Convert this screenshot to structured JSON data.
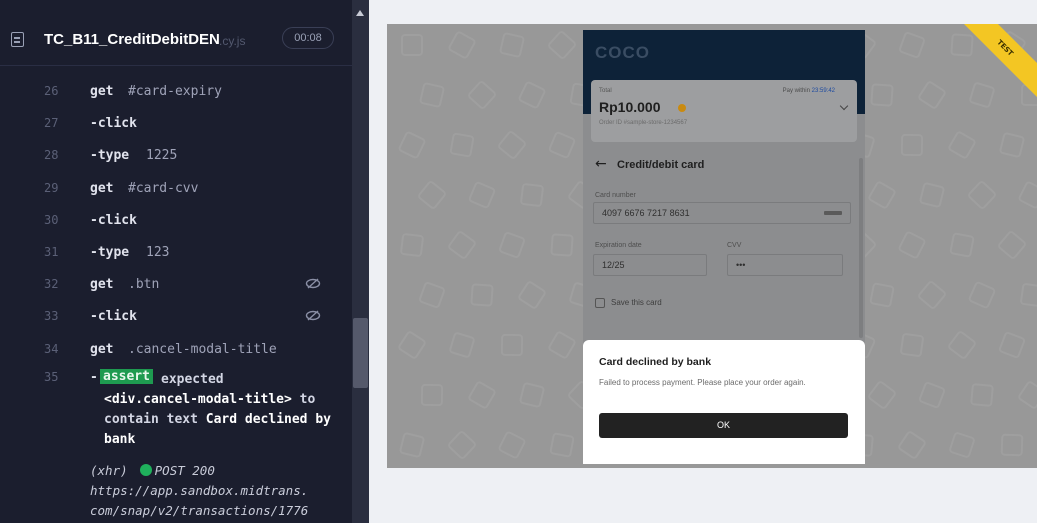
{
  "runner": {
    "spec_name": "TC_B11_CreditDebitDEN",
    "spec_ext": ".cy.js",
    "timer": "00:08"
  },
  "commands": [
    {
      "num": "26",
      "cmd": "get",
      "arg": "#card-expiry"
    },
    {
      "num": "27",
      "cmd": "-click",
      "arg": ""
    },
    {
      "num": "28",
      "cmd": "-type",
      "arg": "1225"
    },
    {
      "num": "29",
      "cmd": "get",
      "arg": "#card-cvv"
    },
    {
      "num": "30",
      "cmd": "-click",
      "arg": ""
    },
    {
      "num": "31",
      "cmd": "-type",
      "arg": "123"
    },
    {
      "num": "32",
      "cmd": "get",
      "arg": ".btn",
      "icon": "eye-slash-icon"
    },
    {
      "num": "33",
      "cmd": "-click",
      "arg": "",
      "icon": "eye-slash-icon"
    },
    {
      "num": "34",
      "cmd": "get",
      "arg": ".cancel-modal-title"
    }
  ],
  "assertion": {
    "num": "35",
    "dash": "-",
    "badge": "assert",
    "w1": "expected",
    "subject": "<div.cancel-modal-title>",
    "w2": "to contain text",
    "expected": "Card declined by bank"
  },
  "xhr": {
    "tag": "(xhr)",
    "method": "POST 200",
    "url_line1": "https://app.sandbox.midtrans.",
    "url_line2": "com/snap/v2/transactions/1776"
  },
  "app": {
    "merchant": "COCO",
    "ribbon": "TEST",
    "total_label": "Total",
    "total_amount": "Rp10.000",
    "order_id": "Order ID #sample-store-1234567",
    "pay_within_label": "Pay within",
    "pay_within_time": "23:59:42",
    "page_title": "Credit/debit card",
    "card_number_label": "Card number",
    "card_number_value": "4097 6676 7217 8631",
    "expiry_label": "Expiration date",
    "expiry_value": "12/25",
    "cvv_label": "CVV",
    "cvv_value": "•••",
    "save_card_label": "Save this card",
    "modal": {
      "title": "Card declined by bank",
      "message": "Failed to process payment. Please place your order again.",
      "ok_label": "OK"
    }
  },
  "colors": {
    "log_bg": "#1b1e2e",
    "assert_badge": "#1e9a50",
    "xhr_dot": "#1fb05c",
    "snap_header": "#0d2238",
    "ok_button": "#222222",
    "ribbon": "#f3c623"
  }
}
